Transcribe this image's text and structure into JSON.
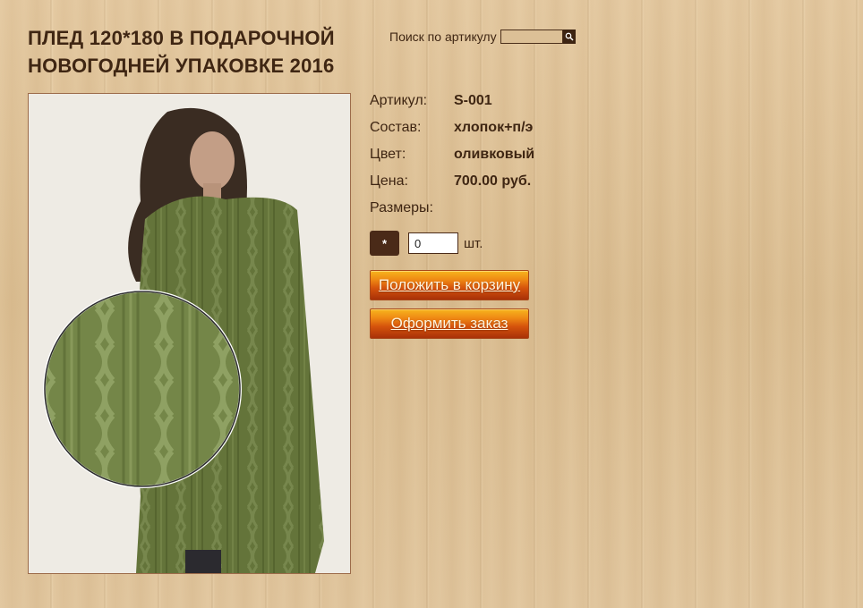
{
  "product": {
    "title": "ПЛЕД 120*180 В ПОДАРОЧНОЙ НОВОГОДНЕЙ УПАКОВКЕ 2016",
    "image_alt": "olive cable-knit blanket"
  },
  "search": {
    "label": "Поиск по артикулу",
    "value": "",
    "button_icon": "search-icon"
  },
  "details": [
    {
      "label": "Артикул:",
      "value": "S-001"
    },
    {
      "label": "Состав:",
      "value": "хлопок+п/э"
    },
    {
      "label": "Цвет:",
      "value": "оливковый"
    },
    {
      "label": "Цена:",
      "value": "700.00 руб."
    },
    {
      "label": "Размеры:",
      "value": ""
    }
  ],
  "order": {
    "size_option": "*",
    "quantity": "0",
    "unit": "шт.",
    "add_to_cart_label": "Положить в корзину",
    "checkout_label": "Оформить заказ"
  },
  "colors": {
    "text": "#3f2613",
    "button_top": "#f7b51e",
    "button_bottom": "#a83108",
    "chip": "#4a2a18"
  }
}
